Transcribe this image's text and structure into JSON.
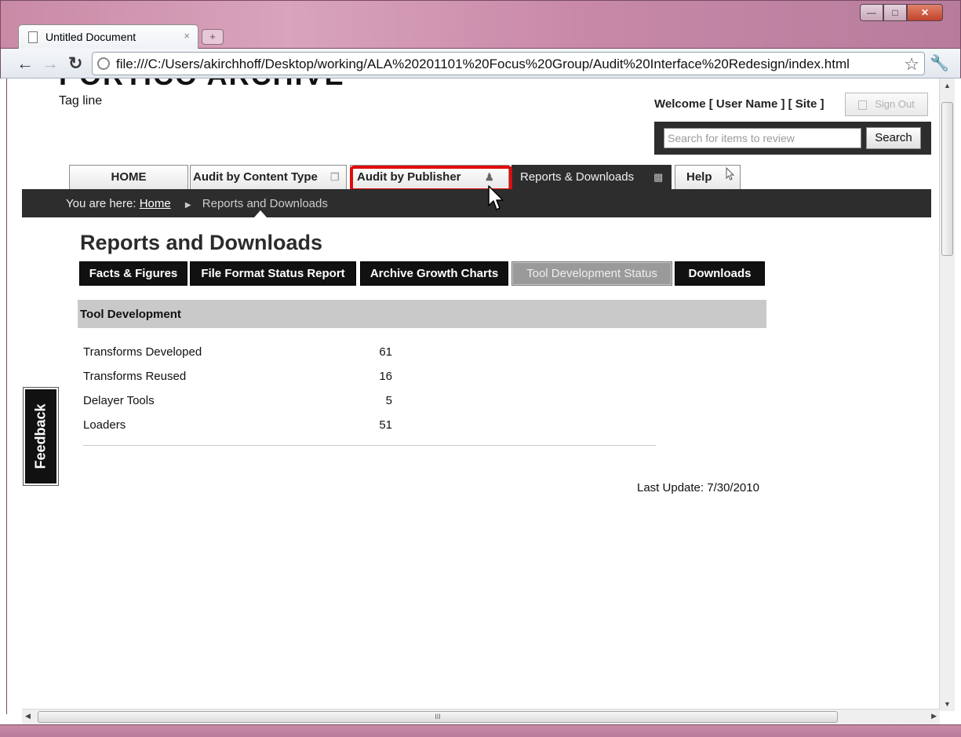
{
  "browser": {
    "tab_title": "Untitled Document",
    "tab_close": "×",
    "new_tab": "+",
    "url": "file:///C:/Users/akirchhoff/Desktop/working/ALA%20201101%20Focus%20Group/Audit%20Interface%20Redesign/index.html",
    "scroll_grip": "III"
  },
  "site": {
    "logo_text": "PORTICO ARCHIVE",
    "tagline": "Tag line"
  },
  "user": {
    "welcome": "Welcome [ User Name ] [ Site ]",
    "sign_out": "Sign Out"
  },
  "search": {
    "placeholder": "Search for items to review",
    "button": "Search"
  },
  "main_nav": {
    "home": "HOME",
    "content_type": "Audit by Content Type",
    "publisher": "Audit by Publisher",
    "reports": "Reports & Downloads",
    "help": "Help"
  },
  "breadcrumb": {
    "prefix": "You are here:",
    "home": "Home",
    "current": "Reports and Downloads"
  },
  "page": {
    "title": "Reports and Downloads"
  },
  "sub_tabs": {
    "facts": "Facts  & Figures",
    "file_format": "File Format Status Report",
    "growth": "Archive Growth Charts",
    "tool_dev": "Tool Development Status",
    "downloads": "Downloads"
  },
  "section": {
    "title": "Tool Development",
    "rows": [
      {
        "label": "Transforms Developed",
        "value": "61"
      },
      {
        "label": "Transforms Reused",
        "value": "16"
      },
      {
        "label": "Delayer Tools",
        "value": "5"
      },
      {
        "label": "Loaders",
        "value": "51"
      }
    ],
    "last_update": "Last Update: 7/30/2010"
  },
  "feedback": "Feedback",
  "colors": {
    "nav_dark": "#2d2d2d",
    "highlight": "#e10b0b",
    "section_header": "#c9c9c9",
    "subtab_active": "#9a9a9a"
  }
}
